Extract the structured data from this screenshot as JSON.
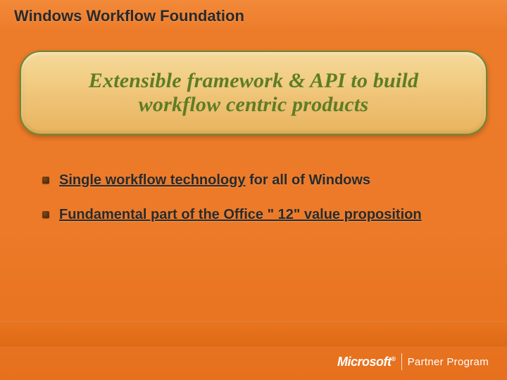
{
  "title": "Windows Workflow Foundation",
  "hero": {
    "line1": "Extensible framework & API to build",
    "line2": "workflow centric products"
  },
  "bullets": [
    {
      "underlined": "Single workflow technology",
      "rest": " for all of Windows"
    },
    {
      "underlined": "Fundamental part of the Office \" 12\" value proposition",
      "rest": ""
    }
  ],
  "footer": {
    "brand": "Microsoft",
    "reg": "®",
    "program": "Partner Program"
  }
}
